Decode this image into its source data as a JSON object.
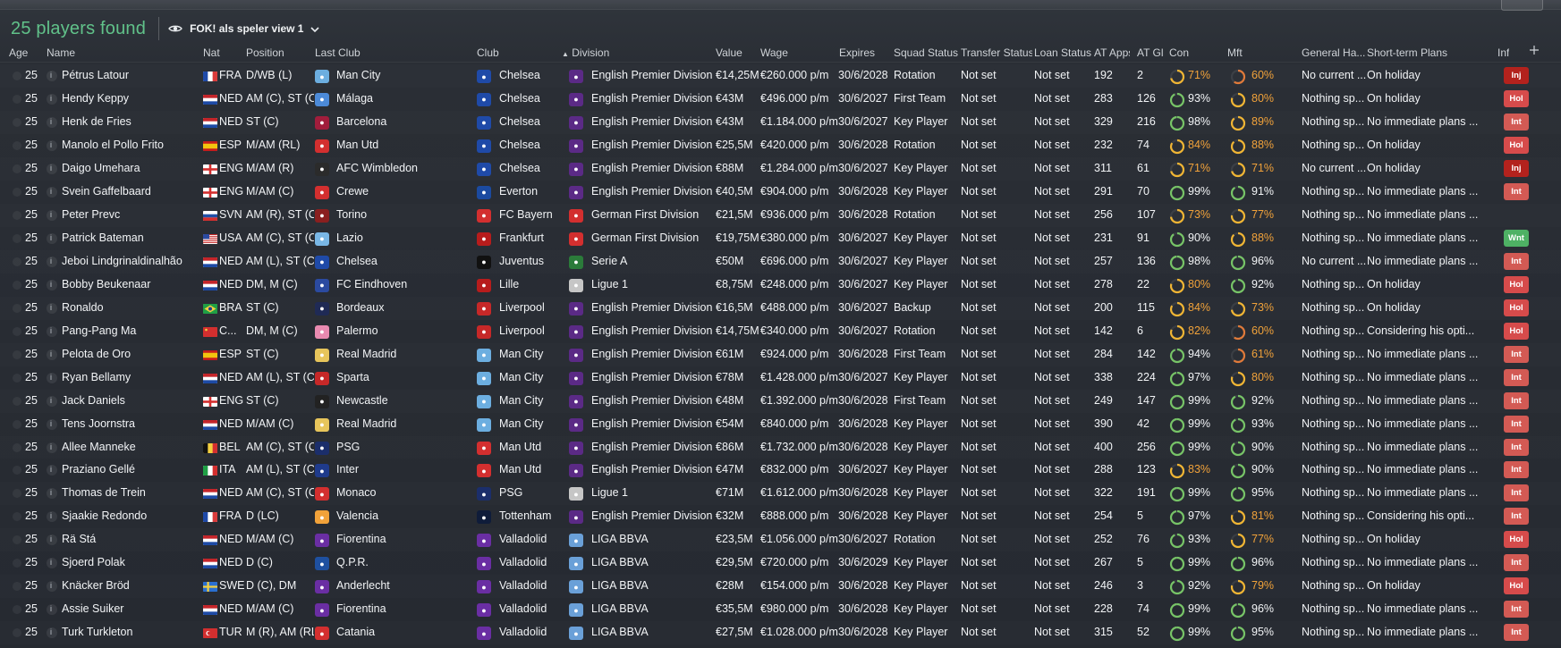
{
  "header": {
    "title": "25 players found",
    "view_label": "FOK! als speler view 1"
  },
  "columns": {
    "age": "Age",
    "name": "Name",
    "nat": "Nat",
    "position": "Position",
    "last_club": "Last Club",
    "club": "Club",
    "division": "Division",
    "value": "Value",
    "wage": "Wage",
    "expires": "Expires",
    "squad_status": "Squad Status",
    "transfer_status": "Transfer Status",
    "loan_status": "Loan Status",
    "at_apps": "AT Apps",
    "at_gls": "AT Gls",
    "con": "Con",
    "mft": "Mft",
    "general_happiness": "General Ha...",
    "short_term_plans": "Short-term Plans",
    "inf": "Inf"
  },
  "colors": {
    "accent_green": "#61c28a",
    "gauge_green": "#77c467",
    "gauge_yellow": "#f0b534",
    "gauge_orange": "#e07a3a",
    "badge_inj": "#b3221d",
    "badge_hol": "#d64b4b",
    "badge_int": "#d35a54",
    "badge_wnt": "#4eb164"
  },
  "rows": [
    {
      "age": "25",
      "name": "Pétrus Latour",
      "nat": "FRA",
      "position": "D/WB (L)",
      "last_club": "Man City",
      "club": "Chelsea",
      "division": "English Premier Division",
      "value": "€14,25M",
      "wage": "€260.000 p/m",
      "expires": "30/6/2028",
      "squad_status": "Rotation",
      "transfer_status": "Not set",
      "loan_status": "Not set",
      "at_apps": "192",
      "at_gls": "2",
      "con": "71%",
      "con_value": 0.71,
      "mft": "60%",
      "mft_value": 0.6,
      "general_happiness": "No current ...",
      "short_term_plans": "On holiday",
      "inf": "Inj",
      "flag": "fr",
      "lastclub_crest": "mancity",
      "club_crest": "chelsea",
      "div_crest": "epl"
    },
    {
      "age": "25",
      "name": "Hendy Keppy",
      "nat": "NED",
      "position": "AM (C), ST (C)",
      "last_club": "Málaga",
      "club": "Chelsea",
      "division": "English Premier Division",
      "value": "€43M",
      "wage": "€496.000 p/m",
      "expires": "30/6/2027",
      "squad_status": "First Team",
      "transfer_status": "Not set",
      "loan_status": "Not set",
      "at_apps": "283",
      "at_gls": "126",
      "con": "93%",
      "con_value": 0.93,
      "mft": "80%",
      "mft_value": 0.8,
      "general_happiness": "Nothing sp...",
      "short_term_plans": "On holiday",
      "inf": "Hol",
      "flag": "nl",
      "lastclub_crest": "malaga",
      "club_crest": "chelsea",
      "div_crest": "epl"
    },
    {
      "age": "25",
      "name": "Henk de Fries",
      "nat": "NED",
      "position": "ST (C)",
      "last_club": "Barcelona",
      "club": "Chelsea",
      "division": "English Premier Division",
      "value": "€43M",
      "wage": "€1.184.000 p/m",
      "expires": "30/6/2027",
      "squad_status": "Key Player",
      "transfer_status": "Not set",
      "loan_status": "Not set",
      "at_apps": "329",
      "at_gls": "216",
      "con": "98%",
      "con_value": 0.98,
      "mft": "89%",
      "mft_value": 0.89,
      "general_happiness": "Nothing sp...",
      "short_term_plans": "No immediate plans ...",
      "inf": "Int",
      "flag": "nl",
      "lastclub_crest": "barca",
      "club_crest": "chelsea",
      "div_crest": "epl"
    },
    {
      "age": "25",
      "name": "Manolo el Pollo Frito",
      "nat": "ESP",
      "position": "M/AM (RL)",
      "last_club": "Man Utd",
      "club": "Chelsea",
      "division": "English Premier Division",
      "value": "€25,5M",
      "wage": "€420.000 p/m",
      "expires": "30/6/2028",
      "squad_status": "Rotation",
      "transfer_status": "Not set",
      "loan_status": "Not set",
      "at_apps": "232",
      "at_gls": "74",
      "con": "84%",
      "con_value": 0.84,
      "mft": "88%",
      "mft_value": 0.88,
      "general_happiness": "Nothing sp...",
      "short_term_plans": "On holiday",
      "inf": "Hol",
      "flag": "es",
      "lastclub_crest": "manutd",
      "club_crest": "chelsea",
      "div_crest": "epl"
    },
    {
      "age": "25",
      "name": "Daigo Umehara",
      "nat": "ENG",
      "position": "M/AM (R)",
      "last_club": "AFC Wimbledon",
      "club": "Chelsea",
      "division": "English Premier Division",
      "value": "€88M",
      "wage": "€1.284.000 p/m",
      "expires": "30/6/2027",
      "squad_status": "Key Player",
      "transfer_status": "Not set",
      "loan_status": "Not set",
      "at_apps": "311",
      "at_gls": "61",
      "con": "71%",
      "con_value": 0.71,
      "mft": "71%",
      "mft_value": 0.71,
      "general_happiness": "No current ...",
      "short_term_plans": "On holiday",
      "inf": "Inj",
      "flag": "en",
      "lastclub_crest": "afcw",
      "club_crest": "chelsea",
      "div_crest": "epl"
    },
    {
      "age": "25",
      "name": "Svein Gaffelbaard",
      "nat": "ENG",
      "position": "M/AM (C)",
      "last_club": "Crewe",
      "club": "Everton",
      "division": "English Premier Division",
      "value": "€40,5M",
      "wage": "€904.000 p/m",
      "expires": "30/6/2028",
      "squad_status": "Key Player",
      "transfer_status": "Not set",
      "loan_status": "Not set",
      "at_apps": "291",
      "at_gls": "70",
      "con": "99%",
      "con_value": 0.99,
      "mft": "91%",
      "mft_value": 0.91,
      "general_happiness": "Nothing sp...",
      "short_term_plans": "No immediate plans ...",
      "inf": "Int",
      "flag": "en",
      "lastclub_crest": "crewe",
      "club_crest": "everton",
      "div_crest": "epl"
    },
    {
      "age": "25",
      "name": "Peter Prevc",
      "nat": "SVN",
      "position": "AM (R), ST (C)",
      "last_club": "Torino",
      "club": "FC Bayern",
      "division": "German First Division",
      "value": "€21,5M",
      "wage": "€936.000 p/m",
      "expires": "30/6/2028",
      "squad_status": "Rotation",
      "transfer_status": "Not set",
      "loan_status": "Not set",
      "at_apps": "256",
      "at_gls": "107",
      "con": "73%",
      "con_value": 0.73,
      "mft": "77%",
      "mft_value": 0.77,
      "general_happiness": "Nothing sp...",
      "short_term_plans": "No immediate plans ...",
      "inf": "",
      "flag": "si",
      "lastclub_crest": "torino",
      "club_crest": "bayern",
      "div_crest": "bundesliga"
    },
    {
      "age": "25",
      "name": "Patrick Bateman",
      "nat": "USA",
      "position": "AM (C), ST (C)",
      "last_club": "Lazio",
      "club": "Frankfurt",
      "division": "German First Division",
      "value": "€19,75M",
      "wage": "€380.000 p/m",
      "expires": "30/6/2027",
      "squad_status": "Key Player",
      "transfer_status": "Not set",
      "loan_status": "Not set",
      "at_apps": "231",
      "at_gls": "91",
      "con": "90%",
      "con_value": 0.9,
      "mft": "88%",
      "mft_value": 0.88,
      "general_happiness": "Nothing sp...",
      "short_term_plans": "No immediate plans ...",
      "inf": "Wnt",
      "flag": "us",
      "lastclub_crest": "lazio",
      "club_crest": "frankfurt",
      "div_crest": "bundesliga"
    },
    {
      "age": "25",
      "name": "Jeboi Lindgrinaldinalhão",
      "nat": "NED",
      "position": "AM (L), ST (C)",
      "last_club": "Chelsea",
      "club": "Juventus",
      "division": "Serie A",
      "value": "€50M",
      "wage": "€696.000 p/m",
      "expires": "30/6/2027",
      "squad_status": "Key Player",
      "transfer_status": "Not set",
      "loan_status": "Not set",
      "at_apps": "257",
      "at_gls": "136",
      "con": "98%",
      "con_value": 0.98,
      "mft": "96%",
      "mft_value": 0.96,
      "general_happiness": "No current ...",
      "short_term_plans": "No immediate plans ...",
      "inf": "Int",
      "flag": "nl",
      "lastclub_crest": "chelsea",
      "club_crest": "juventus",
      "div_crest": "seriea"
    },
    {
      "age": "25",
      "name": "Bobby Beukenaar",
      "nat": "NED",
      "position": "DM, M (C)",
      "last_club": "FC Eindhoven",
      "club": "Lille",
      "division": "Ligue 1",
      "value": "€8,75M",
      "wage": "€248.000 p/m",
      "expires": "30/6/2027",
      "squad_status": "Key Player",
      "transfer_status": "Not set",
      "loan_status": "Not set",
      "at_apps": "278",
      "at_gls": "22",
      "con": "80%",
      "con_value": 0.8,
      "mft": "92%",
      "mft_value": 0.92,
      "general_happiness": "Nothing sp...",
      "short_term_plans": "On holiday",
      "inf": "Hol",
      "flag": "nl",
      "lastclub_crest": "eindhoven",
      "club_crest": "lille",
      "div_crest": "ligue1"
    },
    {
      "age": "25",
      "name": "Ronaldo",
      "nat": "BRA",
      "position": "ST (C)",
      "last_club": "Bordeaux",
      "club": "Liverpool",
      "division": "English Premier Division",
      "value": "€16,5M",
      "wage": "€488.000 p/m",
      "expires": "30/6/2027",
      "squad_status": "Backup",
      "transfer_status": "Not set",
      "loan_status": "Not set",
      "at_apps": "200",
      "at_gls": "115",
      "con": "84%",
      "con_value": 0.84,
      "mft": "73%",
      "mft_value": 0.73,
      "general_happiness": "Nothing sp...",
      "short_term_plans": "On holiday",
      "inf": "Hol",
      "flag": "br",
      "lastclub_crest": "bordeaux",
      "club_crest": "liverpool",
      "div_crest": "epl"
    },
    {
      "age": "25",
      "name": "Pang-Pang Ma",
      "nat": "C...",
      "position": "DM, M (C)",
      "last_club": "Palermo",
      "club": "Liverpool",
      "division": "English Premier Division",
      "value": "€14,75M",
      "wage": "€340.000 p/m",
      "expires": "30/6/2027",
      "squad_status": "Rotation",
      "transfer_status": "Not set",
      "loan_status": "Not set",
      "at_apps": "142",
      "at_gls": "6",
      "con": "82%",
      "con_value": 0.82,
      "mft": "60%",
      "mft_value": 0.6,
      "general_happiness": "Nothing sp...",
      "short_term_plans": "Considering his opti...",
      "inf": "Hol",
      "flag": "cn",
      "lastclub_crest": "palermo",
      "club_crest": "liverpool",
      "div_crest": "epl"
    },
    {
      "age": "25",
      "name": "Pelota de Oro",
      "nat": "ESP",
      "position": "ST (C)",
      "last_club": "Real Madrid",
      "club": "Man City",
      "division": "English Premier Division",
      "value": "€61M",
      "wage": "€924.000 p/m",
      "expires": "30/6/2028",
      "squad_status": "First Team",
      "transfer_status": "Not set",
      "loan_status": "Not set",
      "at_apps": "284",
      "at_gls": "142",
      "con": "94%",
      "con_value": 0.94,
      "mft": "61%",
      "mft_value": 0.61,
      "general_happiness": "Nothing sp...",
      "short_term_plans": "No immediate plans ...",
      "inf": "Int",
      "flag": "es",
      "lastclub_crest": "realmadrid",
      "club_crest": "mancity",
      "div_crest": "epl"
    },
    {
      "age": "25",
      "name": "Ryan Bellamy",
      "nat": "NED",
      "position": "AM (L), ST (C)",
      "last_club": "Sparta",
      "club": "Man City",
      "division": "English Premier Division",
      "value": "€78M",
      "wage": "€1.428.000 p/m",
      "expires": "30/6/2027",
      "squad_status": "Key Player",
      "transfer_status": "Not set",
      "loan_status": "Not set",
      "at_apps": "338",
      "at_gls": "224",
      "con": "97%",
      "con_value": 0.97,
      "mft": "80%",
      "mft_value": 0.8,
      "general_happiness": "Nothing sp...",
      "short_term_plans": "No immediate plans ...",
      "inf": "Int",
      "flag": "nl",
      "lastclub_crest": "sparta",
      "club_crest": "mancity",
      "div_crest": "epl"
    },
    {
      "age": "25",
      "name": "Jack Daniels",
      "nat": "ENG",
      "position": "ST (C)",
      "last_club": "Newcastle",
      "club": "Man City",
      "division": "English Premier Division",
      "value": "€48M",
      "wage": "€1.392.000 p/m",
      "expires": "30/6/2028",
      "squad_status": "First Team",
      "transfer_status": "Not set",
      "loan_status": "Not set",
      "at_apps": "249",
      "at_gls": "147",
      "con": "99%",
      "con_value": 0.99,
      "mft": "92%",
      "mft_value": 0.92,
      "general_happiness": "Nothing sp...",
      "short_term_plans": "No immediate plans ...",
      "inf": "Int",
      "flag": "en",
      "lastclub_crest": "newcastle",
      "club_crest": "mancity",
      "div_crest": "epl"
    },
    {
      "age": "25",
      "name": "Tens Joornstra",
      "nat": "NED",
      "position": "M/AM (C)",
      "last_club": "Real Madrid",
      "club": "Man City",
      "division": "English Premier Division",
      "value": "€54M",
      "wage": "€840.000 p/m",
      "expires": "30/6/2028",
      "squad_status": "Key Player",
      "transfer_status": "Not set",
      "loan_status": "Not set",
      "at_apps": "390",
      "at_gls": "42",
      "con": "99%",
      "con_value": 0.99,
      "mft": "93%",
      "mft_value": 0.93,
      "general_happiness": "Nothing sp...",
      "short_term_plans": "No immediate plans ...",
      "inf": "Int",
      "flag": "nl",
      "lastclub_crest": "realmadrid",
      "club_crest": "mancity",
      "div_crest": "epl"
    },
    {
      "age": "25",
      "name": "Allee Manneke",
      "nat": "BEL",
      "position": "AM (C), ST (C)",
      "last_club": "PSG",
      "club": "Man Utd",
      "division": "English Premier Division",
      "value": "€86M",
      "wage": "€1.732.000 p/m",
      "expires": "30/6/2028",
      "squad_status": "Key Player",
      "transfer_status": "Not set",
      "loan_status": "Not set",
      "at_apps": "400",
      "at_gls": "256",
      "con": "99%",
      "con_value": 0.99,
      "mft": "90%",
      "mft_value": 0.9,
      "general_happiness": "Nothing sp...",
      "short_term_plans": "No immediate plans ...",
      "inf": "Int",
      "flag": "be",
      "lastclub_crest": "psg",
      "club_crest": "manutd",
      "div_crest": "epl"
    },
    {
      "age": "25",
      "name": "Praziano Gellé",
      "nat": "ITA",
      "position": "AM (L), ST (C)",
      "last_club": "Inter",
      "club": "Man Utd",
      "division": "English Premier Division",
      "value": "€47M",
      "wage": "€832.000 p/m",
      "expires": "30/6/2027",
      "squad_status": "Key Player",
      "transfer_status": "Not set",
      "loan_status": "Not set",
      "at_apps": "288",
      "at_gls": "123",
      "con": "83%",
      "con_value": 0.83,
      "mft": "90%",
      "mft_value": 0.9,
      "general_happiness": "Nothing sp...",
      "short_term_plans": "No immediate plans ...",
      "inf": "Int",
      "flag": "it",
      "lastclub_crest": "inter",
      "club_crest": "manutd",
      "div_crest": "epl"
    },
    {
      "age": "25",
      "name": "Thomas de Trein",
      "nat": "NED",
      "position": "AM (C), ST (C)",
      "last_club": "Monaco",
      "club": "PSG",
      "division": "Ligue 1",
      "value": "€71M",
      "wage": "€1.612.000 p/m",
      "expires": "30/6/2028",
      "squad_status": "Key Player",
      "transfer_status": "Not set",
      "loan_status": "Not set",
      "at_apps": "322",
      "at_gls": "191",
      "con": "99%",
      "con_value": 0.99,
      "mft": "95%",
      "mft_value": 0.95,
      "general_happiness": "Nothing sp...",
      "short_term_plans": "No immediate plans ...",
      "inf": "Int",
      "flag": "nl",
      "lastclub_crest": "monaco",
      "club_crest": "psg",
      "div_crest": "ligue1"
    },
    {
      "age": "25",
      "name": "Sjaakie Redondo",
      "nat": "FRA",
      "position": "D (LC)",
      "last_club": "Valencia",
      "club": "Tottenham",
      "division": "English Premier Division",
      "value": "€32M",
      "wage": "€888.000 p/m",
      "expires": "30/6/2028",
      "squad_status": "Key Player",
      "transfer_status": "Not set",
      "loan_status": "Not set",
      "at_apps": "254",
      "at_gls": "5",
      "con": "97%",
      "con_value": 0.97,
      "mft": "81%",
      "mft_value": 0.81,
      "general_happiness": "Nothing sp...",
      "short_term_plans": "Considering his opti...",
      "inf": "Int",
      "flag": "fr",
      "lastclub_crest": "valencia",
      "club_crest": "tottenham",
      "div_crest": "epl"
    },
    {
      "age": "25",
      "name": "Rä Stá",
      "nat": "NED",
      "position": "M/AM (C)",
      "last_club": "Fiorentina",
      "club": "Valladolid",
      "division": "LIGA BBVA",
      "value": "€23,5M",
      "wage": "€1.056.000 p/m",
      "expires": "30/6/2027",
      "squad_status": "Rotation",
      "transfer_status": "Not set",
      "loan_status": "Not set",
      "at_apps": "252",
      "at_gls": "76",
      "con": "93%",
      "con_value": 0.93,
      "mft": "77%",
      "mft_value": 0.77,
      "general_happiness": "Nothing sp...",
      "short_term_plans": "On holiday",
      "inf": "Hol",
      "flag": "nl",
      "lastclub_crest": "fiorentina",
      "club_crest": "valladolid",
      "div_crest": "laliga"
    },
    {
      "age": "25",
      "name": "Sjoerd Polak",
      "nat": "NED",
      "position": "D (C)",
      "last_club": "Q.P.R.",
      "club": "Valladolid",
      "division": "LIGA BBVA",
      "value": "€29,5M",
      "wage": "€720.000 p/m",
      "expires": "30/6/2029",
      "squad_status": "Key Player",
      "transfer_status": "Not set",
      "loan_status": "Not set",
      "at_apps": "267",
      "at_gls": "5",
      "con": "99%",
      "con_value": 0.99,
      "mft": "96%",
      "mft_value": 0.96,
      "general_happiness": "Nothing sp...",
      "short_term_plans": "No immediate plans ...",
      "inf": "Int",
      "flag": "nl",
      "lastclub_crest": "qpr",
      "club_crest": "valladolid",
      "div_crest": "laliga"
    },
    {
      "age": "25",
      "name": "Knäcker Bröd",
      "nat": "SWE",
      "position": "D (C), DM",
      "last_club": "Anderlecht",
      "club": "Valladolid",
      "division": "LIGA BBVA",
      "value": "€28M",
      "wage": "€154.000 p/m",
      "expires": "30/6/2028",
      "squad_status": "Key Player",
      "transfer_status": "Not set",
      "loan_status": "Not set",
      "at_apps": "246",
      "at_gls": "3",
      "con": "92%",
      "con_value": 0.92,
      "mft": "79%",
      "mft_value": 0.79,
      "general_happiness": "Nothing sp...",
      "short_term_plans": "On holiday",
      "inf": "Hol",
      "flag": "se",
      "lastclub_crest": "anderlecht",
      "club_crest": "valladolid",
      "div_crest": "laliga"
    },
    {
      "age": "25",
      "name": "Assie Suiker",
      "nat": "NED",
      "position": "M/AM (C)",
      "last_club": "Fiorentina",
      "club": "Valladolid",
      "division": "LIGA BBVA",
      "value": "€35,5M",
      "wage": "€980.000 p/m",
      "expires": "30/6/2028",
      "squad_status": "Key Player",
      "transfer_status": "Not set",
      "loan_status": "Not set",
      "at_apps": "228",
      "at_gls": "74",
      "con": "99%",
      "con_value": 0.99,
      "mft": "96%",
      "mft_value": 0.96,
      "general_happiness": "Nothing sp...",
      "short_term_plans": "No immediate plans ...",
      "inf": "Int",
      "flag": "nl",
      "lastclub_crest": "fiorentina",
      "club_crest": "valladolid",
      "div_crest": "laliga"
    },
    {
      "age": "25",
      "name": "Turk Turkleton",
      "nat": "TUR",
      "position": "M (R), AM (RL)",
      "last_club": "Catania",
      "club": "Valladolid",
      "division": "LIGA BBVA",
      "value": "€27,5M",
      "wage": "€1.028.000 p/m",
      "expires": "30/6/2028",
      "squad_status": "Key Player",
      "transfer_status": "Not set",
      "loan_status": "Not set",
      "at_apps": "315",
      "at_gls": "52",
      "con": "99%",
      "con_value": 0.99,
      "mft": "95%",
      "mft_value": 0.95,
      "general_happiness": "Nothing sp...",
      "short_term_plans": "No immediate plans ...",
      "inf": "Int",
      "flag": "tr",
      "lastclub_crest": "catania",
      "club_crest": "valladolid",
      "div_crest": "laliga"
    }
  ]
}
